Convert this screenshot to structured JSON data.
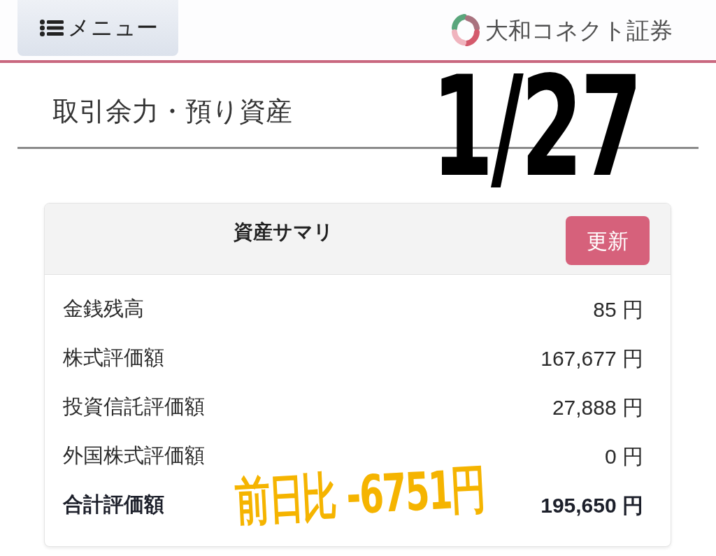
{
  "header": {
    "menu_button": {
      "label": "メニュー"
    },
    "logo": {
      "text": "大和コネクト証券"
    }
  },
  "title_section": {
    "title": "取引余力・預り資産",
    "handwritten_note": "1/27"
  },
  "summary": {
    "title": "資産サマリ",
    "refresh_button": "更新",
    "rows": [
      {
        "kind": "item",
        "label": "金銭残高",
        "value": "85 円"
      },
      {
        "kind": "item",
        "label": "株式評価額",
        "value": "167,677 円"
      },
      {
        "kind": "item",
        "label": "投資信託評価額",
        "value": "27,888 円"
      },
      {
        "kind": "item",
        "label": "外国株式評価額",
        "value": "0 円"
      },
      {
        "kind": "total",
        "label": "合計評価額",
        "value": "195,650 円"
      }
    ],
    "handwritten_note": "前日比 -6751円"
  }
}
